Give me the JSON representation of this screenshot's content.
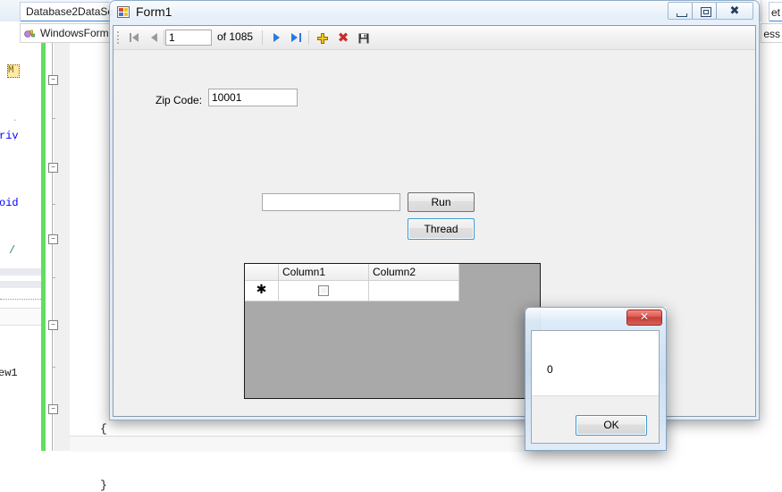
{
  "vs": {
    "tab_label": "Database2DataSe",
    "breadcrumb_label": "WindowsForm",
    "right_tab_label": "et",
    "right_sub_label": "ess",
    "code_fragments": [
      {
        "text": "riv",
        "color": "#0000ff"
      },
      {
        "text": "oid",
        "color": "#0000ff"
      },
      {
        "text": "/",
        "color": "#2e8b57"
      },
      {
        "text": "ew1",
        "color": "#1c1c1c"
      },
      {
        "text": "M",
        "color": "#806000"
      }
    ],
    "editor_brace": "{",
    "editor_brace2": "}",
    "collapse_glyph": "−"
  },
  "form1": {
    "title": "Form1",
    "icon": "winforms-icon",
    "window_buttons": {
      "minimize": "minimize-icon",
      "maximize": "maximize-icon",
      "close": "close-icon"
    },
    "binding_navigator": {
      "first_label": "move-first-icon",
      "prev_label": "move-previous-icon",
      "position_value": "1",
      "count_text": "of 1085",
      "next_label": "move-next-icon",
      "last_label": "move-last-icon",
      "add_label": "add-new-icon",
      "delete_label": "delete-icon",
      "save_label": "save-icon"
    },
    "zip": {
      "label": "Zip Code:",
      "value": "10001",
      "placeholder": ""
    },
    "run_row": {
      "input_value": "",
      "input_placeholder": "",
      "run_button": "Run",
      "thread_button": "Thread"
    },
    "grid": {
      "columns": [
        "Column1",
        "Column2"
      ],
      "new_row_marker": "✱",
      "rows": [
        {
          "Column1": "",
          "Column2": ""
        }
      ]
    }
  },
  "messagebox": {
    "title": "",
    "message": "0",
    "ok_label": "OK",
    "close_glyph": "✕"
  },
  "colors": {
    "form_background": "#f0f0f0",
    "grid_background": "#a9a9a9",
    "accent_blue": "#3c99d4",
    "nav_blue": "#2a7ade",
    "delete_red": "#cc2b2b",
    "add_yellow": "#f5c518",
    "close_red": "#c33c34",
    "change_bar_green": "#5ee05e"
  }
}
